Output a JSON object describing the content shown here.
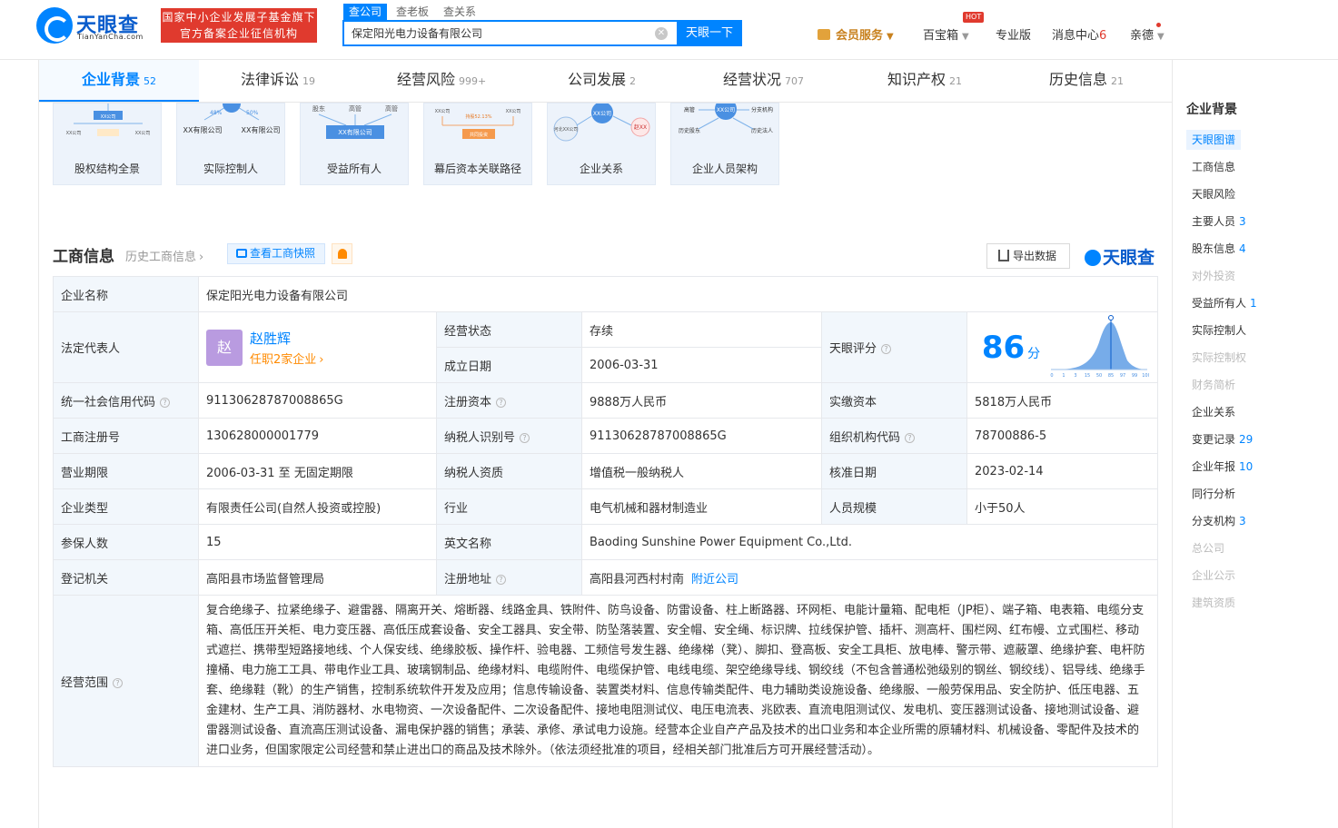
{
  "header": {
    "logo_text": "天眼查",
    "logo_sub": "TianYanCha.com",
    "badge_line1": "国家中小企业发展子基金旗下",
    "badge_line2": "官方备案企业征信机构",
    "search_tabs": [
      "查公司",
      "查老板",
      "查关系"
    ],
    "search_value": "保定阳光电力设备有限公司",
    "search_button": "天眼一下",
    "vip": "会员服务",
    "toolbox": "百宝箱",
    "hot": "HOT",
    "pro": "专业版",
    "messages": "消息中心",
    "message_count": "6",
    "user": "亲德"
  },
  "tabs": [
    {
      "label": "企业背景",
      "count": "52"
    },
    {
      "label": "法律诉讼",
      "count": "19"
    },
    {
      "label": "经营风险",
      "count": "999+"
    },
    {
      "label": "公司发展",
      "count": "2"
    },
    {
      "label": "经营状况",
      "count": "707"
    },
    {
      "label": "知识产权",
      "count": "21"
    },
    {
      "label": "历史信息",
      "count": "21"
    }
  ],
  "cards": [
    {
      "label": "股权结构全景"
    },
    {
      "label": "实际控制人"
    },
    {
      "label": "受益所有人"
    },
    {
      "label": "幕后资本关联路径"
    },
    {
      "label": "企业关系"
    },
    {
      "label": "企业人员架构"
    }
  ],
  "card_texts": {
    "xx_company": "XX公司",
    "xx_ltd": "XX有限公司",
    "shareholder": "股东",
    "executive": "高管",
    "hebei_xx": "河北XX公司",
    "zhao_xx": "赵XX",
    "branch": "分支机构",
    "hist_holder": "历史股东",
    "hist_legal": "历史法人",
    "ratio_a": "48%",
    "ratio_b": "50%",
    "share_ratio": "持股52.13%",
    "common_invest": "共同投资"
  },
  "section": {
    "title": "工商信息",
    "history_link": "历史工商信息",
    "snapshot_button": "查看工商快照",
    "export_button": "导出数据",
    "watermark": "天眼查"
  },
  "info": {
    "company_name_label": "企业名称",
    "company_name": "保定阳光电力设备有限公司",
    "legal_rep_label": "法定代表人",
    "legal_rep_avatar": "赵",
    "legal_rep_name": "赵胜辉",
    "legal_rep_sub": "任职2家企业",
    "status_label": "经营状态",
    "status": "存续",
    "est_date_label": "成立日期",
    "est_date": "2006-03-31",
    "score_label": "天眼评分",
    "score": "86",
    "score_unit": "分",
    "score_axis": [
      "0",
      "1",
      "3",
      "15",
      "50",
      "85",
      "97",
      "99",
      "100"
    ],
    "credit_code_label": "统一社会信用代码",
    "credit_code": "91130628787008865G",
    "reg_capital_label": "注册资本",
    "reg_capital": "9888万人民币",
    "paid_capital_label": "实缴资本",
    "paid_capital": "5818万人民币",
    "reg_no_label": "工商注册号",
    "reg_no": "130628000001779",
    "taxpayer_id_label": "纳税人识别号",
    "taxpayer_id": "91130628787008865G",
    "org_code_label": "组织机构代码",
    "org_code": "78700886-5",
    "term_label": "营业期限",
    "term": "2006-03-31 至 无固定期限",
    "taxpayer_qual_label": "纳税人资质",
    "taxpayer_qual": "增值税一般纳税人",
    "approval_date_label": "核准日期",
    "approval_date": "2023-02-14",
    "type_label": "企业类型",
    "type": "有限责任公司(自然人投资或控股)",
    "industry_label": "行业",
    "industry": "电气机械和器材制造业",
    "staff_label": "人员规模",
    "staff": "小于50人",
    "insured_label": "参保人数",
    "insured": "15",
    "english_label": "英文名称",
    "english": "Baoding Sunshine Power Equipment Co.,Ltd.",
    "authority_label": "登记机关",
    "authority": "高阳县市场监督管理局",
    "address_label": "注册地址",
    "address": "高阳县河西村村南",
    "nearby": "附近公司",
    "scope_label": "经营范围",
    "scope": "复合绝缘子、拉紧绝缘子、避雷器、隔离开关、熔断器、线路金具、铁附件、防鸟设备、防雷设备、柱上断路器、环网柜、电能计量箱、配电柜（JP柜）、端子箱、电表箱、电缆分支箱、高低压开关柜、电力变压器、高低压成套设备、安全工器具、安全带、防坠落装置、安全帽、安全绳、标识牌、拉线保护管、插杆、测高杆、围栏网、红布幔、立式围栏、移动式遮拦、携带型短路接地线、个人保安线、绝缘胶板、操作杆、验电器、工频信号发生器、绝缘梯（凳）、脚扣、登高板、安全工具柜、放电棒、警示带、遮蔽罩、绝缘护套、电杆防撞桶、电力施工工具、带电作业工具、玻璃钢制品、绝缘材料、电缆附件、电缆保护管、电线电缆、架空绝缘导线、钢绞线（不包含普通松弛级别的钢丝、钢绞线）、铝导线、绝缘手套、绝缘鞋（靴）的生产销售，控制系统软件开发及应用；信息传输设备、装置类材料、信息传输类配件、电力辅助类设施设备、绝缘服、一般劳保用品、安全防护、低压电器、五金建材、生产工具、消防器材、水电物资、一次设备配件、二次设备配件、接地电阻测试仪、电压电流表、兆欧表、直流电阻测试仪、发电机、变压器测试设备、接地测试设备、避雷器测试设备、直流高压测试设备、漏电保护器的销售；承装、承修、承试电力设施。经营本企业自产产品及技术的出口业务和本企业所需的原辅材料、机械设备、零配件及技术的进口业务，但国家限定公司经营和禁止进出口的商品及技术除外。（依法须经批准的项目，经相关部门批准后方可开展经营活动）。"
  },
  "sidebar": {
    "title": "企业背景",
    "items": [
      {
        "label": "天眼图谱",
        "count": "",
        "state": "active"
      },
      {
        "label": "工商信息",
        "count": "",
        "state": "normal"
      },
      {
        "label": "天眼风险",
        "count": "",
        "state": "normal"
      },
      {
        "label": "主要人员",
        "count": "3",
        "state": "normal"
      },
      {
        "label": "股东信息",
        "count": "4",
        "state": "normal"
      },
      {
        "label": "对外投资",
        "count": "",
        "state": "disabled"
      },
      {
        "label": "受益所有人",
        "count": "1",
        "state": "normal"
      },
      {
        "label": "实际控制人",
        "count": "",
        "state": "normal"
      },
      {
        "label": "实际控制权",
        "count": "",
        "state": "disabled"
      },
      {
        "label": "财务简析",
        "count": "",
        "state": "disabled"
      },
      {
        "label": "企业关系",
        "count": "",
        "state": "normal"
      },
      {
        "label": "变更记录",
        "count": "29",
        "state": "normal"
      },
      {
        "label": "企业年报",
        "count": "10",
        "state": "normal"
      },
      {
        "label": "同行分析",
        "count": "",
        "state": "normal"
      },
      {
        "label": "分支机构",
        "count": "3",
        "state": "normal"
      },
      {
        "label": "总公司",
        "count": "",
        "state": "disabled"
      },
      {
        "label": "企业公示",
        "count": "",
        "state": "disabled"
      },
      {
        "label": "建筑资质",
        "count": "",
        "state": "disabled"
      }
    ]
  },
  "colors": {
    "accent": "#0084ff",
    "badge": "#e03a2e",
    "label_bg": "#f2f7fc",
    "status": "#22a652",
    "orange": "#ff8a00"
  }
}
